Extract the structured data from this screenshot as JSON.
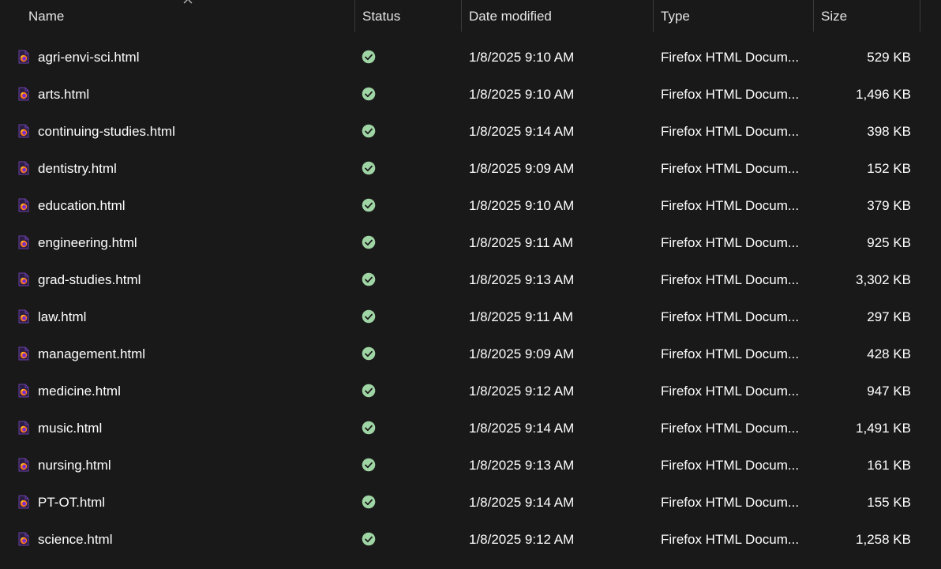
{
  "columns": {
    "name": "Name",
    "status": "Status",
    "date": "Date modified",
    "type": "Type",
    "size": "Size"
  },
  "colors": {
    "background": "#191919",
    "status_ok": "#9fd5a4",
    "firefox_purple": "#5b2a86",
    "firefox_orange": "#ff7a1a"
  },
  "files": [
    {
      "name": "agri-envi-sci.html",
      "date": "1/8/2025 9:10 AM",
      "type": "Firefox HTML Docum...",
      "size": "529 KB"
    },
    {
      "name": "arts.html",
      "date": "1/8/2025 9:10 AM",
      "type": "Firefox HTML Docum...",
      "size": "1,496 KB"
    },
    {
      "name": "continuing-studies.html",
      "date": "1/8/2025 9:14 AM",
      "type": "Firefox HTML Docum...",
      "size": "398 KB"
    },
    {
      "name": "dentistry.html",
      "date": "1/8/2025 9:09 AM",
      "type": "Firefox HTML Docum...",
      "size": "152 KB"
    },
    {
      "name": "education.html",
      "date": "1/8/2025 9:10 AM",
      "type": "Firefox HTML Docum...",
      "size": "379 KB"
    },
    {
      "name": "engineering.html",
      "date": "1/8/2025 9:11 AM",
      "type": "Firefox HTML Docum...",
      "size": "925 KB"
    },
    {
      "name": "grad-studies.html",
      "date": "1/8/2025 9:13 AM",
      "type": "Firefox HTML Docum...",
      "size": "3,302 KB"
    },
    {
      "name": "law.html",
      "date": "1/8/2025 9:11 AM",
      "type": "Firefox HTML Docum...",
      "size": "297 KB"
    },
    {
      "name": "management.html",
      "date": "1/8/2025 9:09 AM",
      "type": "Firefox HTML Docum...",
      "size": "428 KB"
    },
    {
      "name": "medicine.html",
      "date": "1/8/2025 9:12 AM",
      "type": "Firefox HTML Docum...",
      "size": "947 KB"
    },
    {
      "name": "music.html",
      "date": "1/8/2025 9:14 AM",
      "type": "Firefox HTML Docum...",
      "size": "1,491 KB"
    },
    {
      "name": "nursing.html",
      "date": "1/8/2025 9:13 AM",
      "type": "Firefox HTML Docum...",
      "size": "161 KB"
    },
    {
      "name": "PT-OT.html",
      "date": "1/8/2025 9:14 AM",
      "type": "Firefox HTML Docum...",
      "size": "155 KB"
    },
    {
      "name": "science.html",
      "date": "1/8/2025 9:12 AM",
      "type": "Firefox HTML Docum...",
      "size": "1,258 KB"
    }
  ]
}
